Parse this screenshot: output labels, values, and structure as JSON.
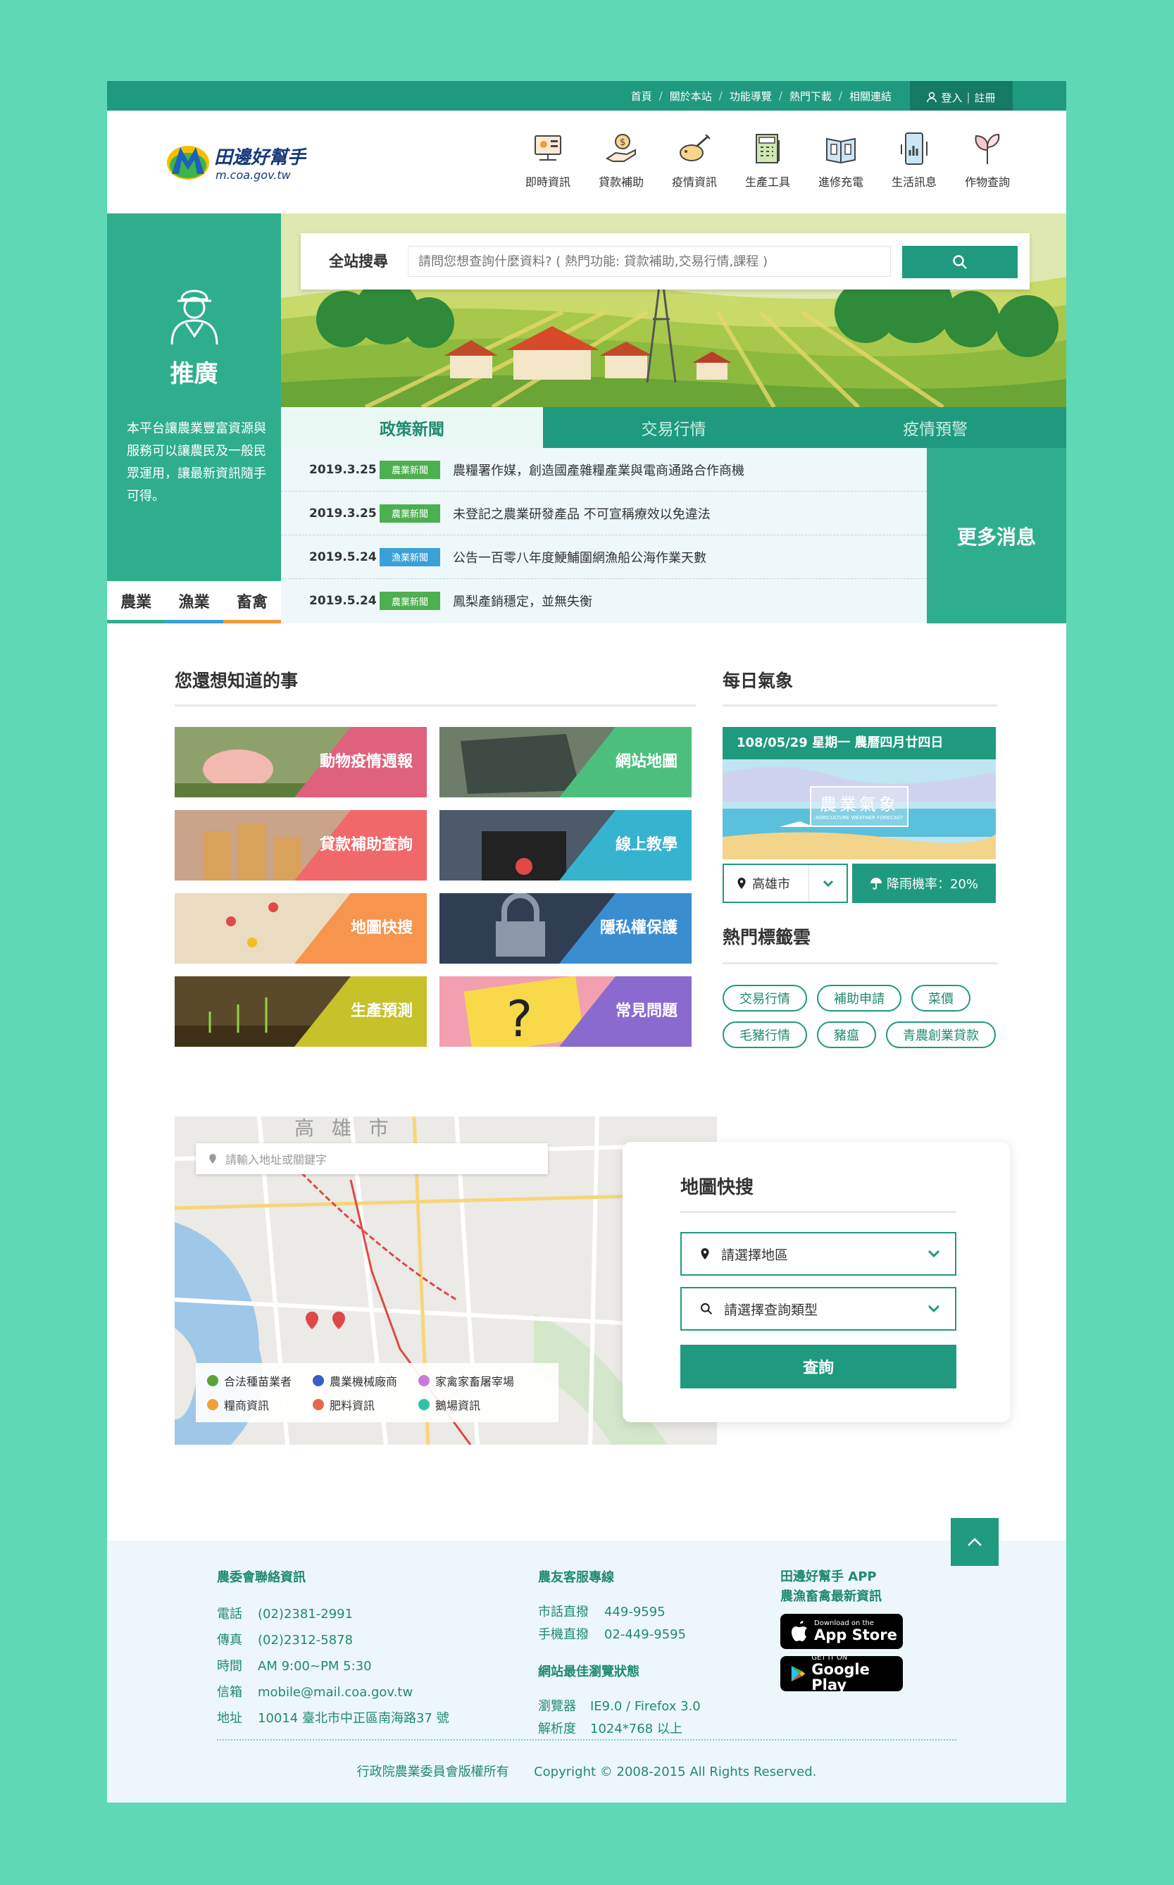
{
  "topbar": {
    "links": [
      "首頁",
      "關於本站",
      "功能導覽",
      "熱門下載",
      "相關連結"
    ],
    "login": "登入",
    "register": "註冊"
  },
  "logo": {
    "title": "田邊好幫手",
    "url": "m.coa.gov.tw"
  },
  "nav": [
    {
      "label": "即時資訊",
      "icon": "news-screen-icon"
    },
    {
      "label": "貸款補助",
      "icon": "money-hand-icon"
    },
    {
      "label": "疫情資訊",
      "icon": "pig-syringe-icon"
    },
    {
      "label": "生產工具",
      "icon": "calculator-icon"
    },
    {
      "label": "進修充電",
      "icon": "book-icon"
    },
    {
      "label": "生活訊息",
      "icon": "phone-chart-icon"
    },
    {
      "label": "作物查詢",
      "icon": "sprout-icon"
    }
  ],
  "promo": {
    "title": "推廣",
    "text": "本平台讓農業豐富資源與服務可以讓農民及一般民眾運用，讓最新資訊隨手可得。",
    "tabs": [
      {
        "label": "農業",
        "color": "#2fae8e"
      },
      {
        "label": "漁業",
        "color": "#3aa0d8"
      },
      {
        "label": "畜禽",
        "color": "#f29a3c"
      }
    ]
  },
  "search": {
    "label": "全站搜尋",
    "placeholder": "請問您想查詢什麼資料? ( 熱門功能: 貸款補助,交易行情,課程 )"
  },
  "news": {
    "tabs": [
      "政策新聞",
      "交易行情",
      "疫情預警"
    ],
    "items": [
      {
        "date": "2019.3.25",
        "tag": "農業新聞",
        "tag_color": "#4caf50",
        "title": "農糧署作媒，創造國產雜糧產業與電商通路合作商機"
      },
      {
        "date": "2019.3.25",
        "tag": "農業新聞",
        "tag_color": "#4caf50",
        "title": "未登記之農業研發產品 不可宣稱療效以免違法"
      },
      {
        "date": "2019.5.24",
        "tag": "漁業新聞",
        "tag_color": "#3aa0d8",
        "title": "公告一百零八年度鯁鯆圍網漁船公海作業天數"
      },
      {
        "date": "2019.5.24",
        "tag": "農業新聞",
        "tag_color": "#4caf50",
        "title": "鳳梨產銷穩定，並無失衡"
      }
    ],
    "more": "更多消息"
  },
  "know": {
    "title": "您還想知道的事",
    "tiles": [
      {
        "label": "動物疫情週報",
        "color": "#e0617c"
      },
      {
        "label": "網站地圖",
        "color": "#4cbf7c"
      },
      {
        "label": "貸款補助查詢",
        "color": "#f0686a"
      },
      {
        "label": "線上教學",
        "color": "#36b3cf"
      },
      {
        "label": "地圖快搜",
        "color": "#f7944e"
      },
      {
        "label": "隱私權保護",
        "color": "#3a8ed0"
      },
      {
        "label": "生產預測",
        "color": "#c7c12a"
      },
      {
        "label": "常見問題",
        "color": "#8b6ad0"
      }
    ]
  },
  "weather": {
    "title": "每日氣象",
    "date": "108/05/29 星期一 農曆四月廿四日",
    "banner": "農業氣象",
    "banner_sub": "AGRICULTURE WEATHER FORECAST",
    "city": "高雄市",
    "rain": "降雨機率：20%"
  },
  "hot_tags": {
    "title": "熱門標籤雲",
    "tags": [
      "交易行情",
      "補助申請",
      "菜價",
      "毛豬行情",
      "豬瘟",
      "青農創業貸款"
    ]
  },
  "map": {
    "search_placeholder": "請輸入地址或關鍵字",
    "city_label": "高 雄 市",
    "legend": [
      {
        "label": "合法種苗業者",
        "color": "#5aa33a"
      },
      {
        "label": "農業機械廠商",
        "color": "#3b5cc4"
      },
      {
        "label": "家禽家畜屠宰場",
        "color": "#c77bd8"
      },
      {
        "label": "糧商資訊",
        "color": "#f2a03a"
      },
      {
        "label": "肥料資訊",
        "color": "#e8674a"
      },
      {
        "label": "鵝場資訊",
        "color": "#2fc2a8"
      }
    ]
  },
  "map_search": {
    "title": "地圖快搜",
    "region": "請選擇地區",
    "type": "請選擇查詢類型",
    "button": "查詢"
  },
  "footer": {
    "contact": {
      "title": "農委會聯絡資訊",
      "rows": [
        {
          "k": "電話",
          "v": "(02)2381-2991"
        },
        {
          "k": "傳真",
          "v": "(02)2312-5878"
        },
        {
          "k": "時間",
          "v": "AM 9:00~PM 5:30"
        },
        {
          "k": "信箱",
          "v": "mobile@mail.coa.gov.tw"
        },
        {
          "k": "地址",
          "v": "10014 臺北市中正區南海路37 號"
        }
      ]
    },
    "hotline": {
      "title": "農友客服專線",
      "rows": [
        {
          "k": "市話直撥",
          "v": "449-9595"
        },
        {
          "k": "手機直撥",
          "v": "02-449-9595"
        }
      ]
    },
    "browser": {
      "title": "網站最佳瀏覽狀態",
      "rows": [
        {
          "k": "瀏覽器",
          "v": "IE9.0 / Firefox 3.0"
        },
        {
          "k": "解析度",
          "v": "1024*768 以上"
        }
      ]
    },
    "app": {
      "title1": "田邊好幫手 APP",
      "title2": "農漁畜禽最新資訊",
      "appstore_small": "Download on the",
      "appstore": "App Store",
      "gplay_small": "GET IT ON",
      "gplay": "Google Play"
    },
    "copyright_left": "行政院農業委員會版權所有",
    "copyright_right": "Copyright © 2008-2015 All Rights Reserved."
  }
}
